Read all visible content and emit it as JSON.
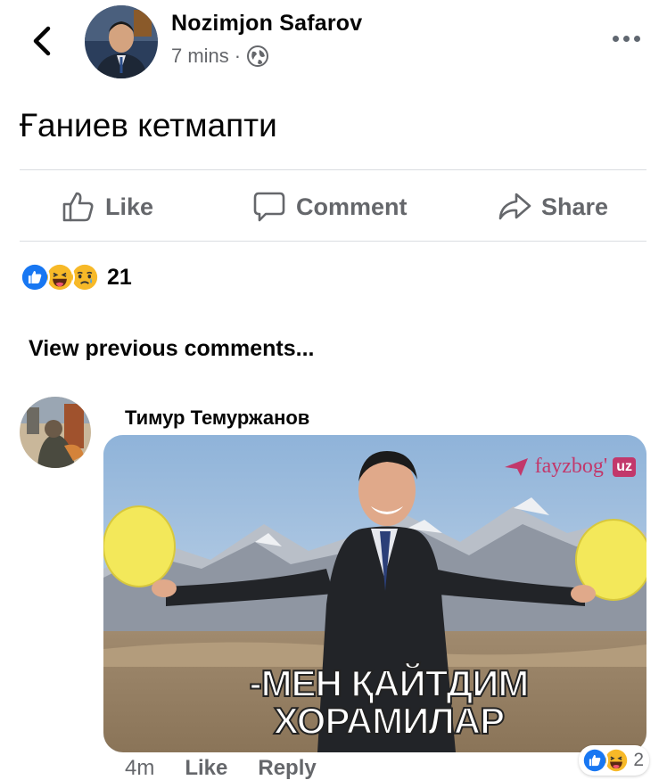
{
  "post": {
    "author": "Nozimjon Safarov",
    "time": "7 mins",
    "separator": "·",
    "text": "Ғаниев кетмапти"
  },
  "actions": {
    "like": "Like",
    "comment": "Comment",
    "share": "Share"
  },
  "reactions": {
    "icons": [
      "like-icon",
      "haha-icon",
      "sad-icon"
    ],
    "count": "21"
  },
  "view_previous": "View previous comments...",
  "comment": {
    "author": "Тимур Темуржанов",
    "image_caption_line1": "-МЕН ҚАЙТДИМ",
    "image_caption_line2": "ХОРАМИЛАР",
    "watermark": "fayzbog'",
    "watermark_badge": "uz",
    "time": "4m",
    "like": "Like",
    "reply": "Reply",
    "reaction_icons": [
      "like-icon",
      "haha-icon"
    ],
    "reaction_count": "2"
  },
  "colors": {
    "like_blue": "#1877f2",
    "haha_yellow": "#f7b928",
    "secondary_text": "#65676b"
  }
}
